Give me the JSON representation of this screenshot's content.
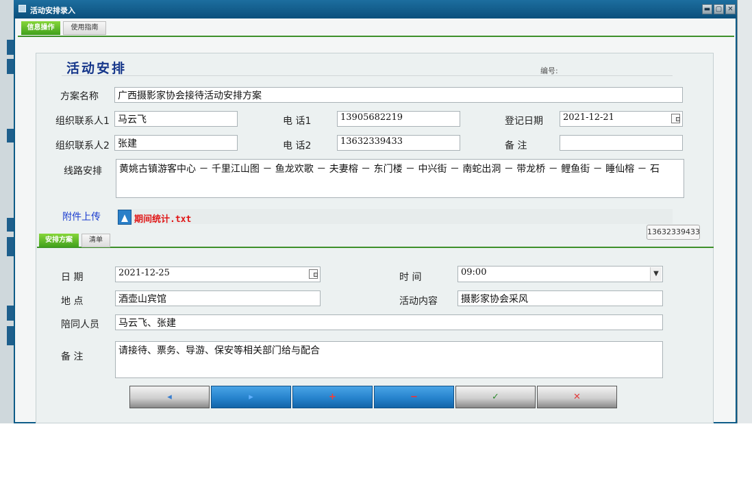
{
  "window": {
    "title": "活动安排录入"
  },
  "tabs": {
    "info": "信息操作",
    "guide": "使用指南"
  },
  "form": {
    "heading": "活动安排",
    "number_label": "编号:",
    "plan_name_label": "方案名称",
    "plan_name_value": "广西摄影家协会接待活动安排方案",
    "contact1_label": "组织联系人1",
    "contact1_value": "马云飞",
    "phone1_label": "电 话1",
    "phone1_value": "13905682219",
    "regdate_label": "登记日期",
    "regdate_value": "2021-12-21",
    "contact2_label": "组织联系人2",
    "contact2_value": "张建",
    "phone2_label": "电 话2",
    "phone2_value": "13632339433",
    "remark_label": "备 注",
    "remark_value": "",
    "route_label": "线路安排",
    "route_value": "黄姚古镇游客中心 － 千里江山图 － 鱼龙欢歌 － 夫妻榕 － 东门楼 － 中兴街 － 南蛇出洞 － 带龙桥 － 鲤鱼街 － 睡仙榕 － 石",
    "attach_label": "附件上传",
    "attach_file": "期间统计.txt",
    "tooltip": "13632339433"
  },
  "subtabs": {
    "plan": "安排方案",
    "list": "清单"
  },
  "detail": {
    "date_label": "日 期",
    "date_value": "2021-12-25",
    "time_label": "时 间",
    "time_value": "09:00",
    "place_label": "地 点",
    "place_value": "酒壶山宾馆",
    "content_label": "活动内容",
    "content_value": "摄影家协会采风",
    "companion_label": "陪同人员",
    "companion_value": "马云飞、张建",
    "note_label": "备 注",
    "note_value": "请接待、票务、导游、保安等相关部门给与配合"
  },
  "buttons": {
    "prev": "◂",
    "next": "▸",
    "add": "+",
    "delete": "−",
    "confirm": "✓",
    "cancel": "✕"
  },
  "colors": {
    "titlebar": "#0b4f7b",
    "tab_active": "#3f9f1c",
    "heading": "#15368a",
    "attach_label": "#1a3ccf",
    "file_name": "#e01515",
    "btn_prev_arrow": "#3a7fd0",
    "btn_next_arrow": "#5fb0ff",
    "btn_add": "#ff3b2f",
    "btn_delete": "#ff2a2a",
    "btn_confirm": "#2e8b2e",
    "btn_cancel": "#e23c3c"
  }
}
